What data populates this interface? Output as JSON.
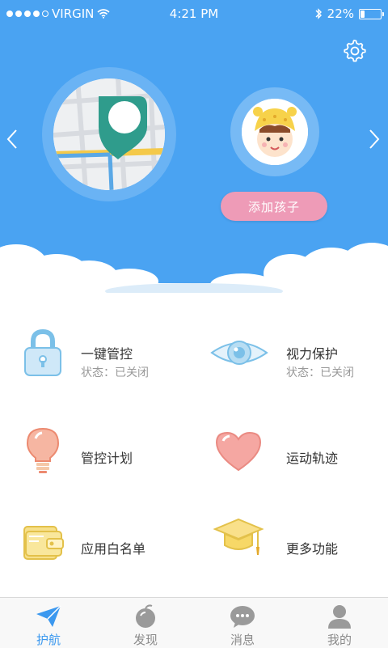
{
  "status_bar": {
    "carrier": "VIRGIN",
    "time": "4:21 PM",
    "battery": "22%",
    "battery_level": 0.22
  },
  "header": {
    "settings_icon": "gear-icon",
    "prev_icon": "chevron-left-icon",
    "next_icon": "chevron-right-icon",
    "add_child_label": "添加孩子"
  },
  "features": [
    {
      "label": "一键管控",
      "status": "状态：已关闭",
      "icon": "lock-icon"
    },
    {
      "label": "视力保护",
      "status": "状态：已关闭",
      "icon": "eye-icon"
    },
    {
      "label": "管控计划",
      "icon": "lightbulb-icon"
    },
    {
      "label": "运动轨迹",
      "icon": "heart-icon"
    },
    {
      "label": "应用白名单",
      "icon": "wallet-icon"
    },
    {
      "label": "更多功能",
      "icon": "graduation-cap-icon"
    }
  ],
  "tabs": [
    {
      "label": "护航",
      "icon": "paper-plane-icon",
      "active": true
    },
    {
      "label": "发现",
      "icon": "discover-icon",
      "active": false
    },
    {
      "label": "消息",
      "icon": "chat-icon",
      "active": false
    },
    {
      "label": "我的",
      "icon": "person-icon",
      "active": false
    }
  ],
  "colors": {
    "hero_background": "#4aa3f2",
    "add_child_button": "#ee9bb7",
    "active_tab": "#3b98ef"
  }
}
